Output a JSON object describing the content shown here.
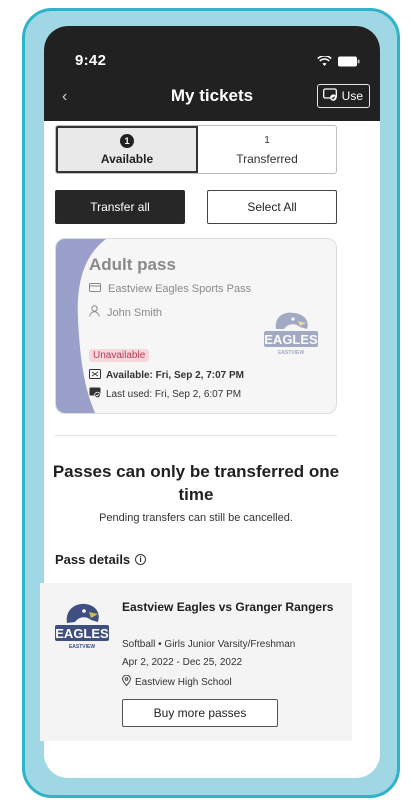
{
  "status_bar": {
    "time": "9:42"
  },
  "nav": {
    "title": "My tickets",
    "use_label": "Use"
  },
  "tabs": [
    {
      "count": "1",
      "label": "Available",
      "active": true
    },
    {
      "count": "1",
      "label": "Transferred",
      "active": false
    }
  ],
  "actions": {
    "transfer_all": "Transfer all",
    "select_all": "Select All"
  },
  "pass": {
    "title": "Adult pass",
    "pass_name": "Eastview Eagles Sports Pass",
    "holder": "John Smith",
    "status_badge": "Unavailable",
    "available_text": "Available: Fri, Sep 2, 7:07 PM",
    "last_used_text": "Last used: Fri, Sep 2, 6:07 PM",
    "logo_text": "EAGLES",
    "logo_subtext": "EASTVIEW"
  },
  "notice": {
    "headline": "Passes can only be transferred one time",
    "subline": "Pending transfers can still be cancelled."
  },
  "details": {
    "label": "Pass details",
    "event_title": "Eastview Eagles vs Granger Rangers",
    "sport_line": "Softball • Girls Junior Varsity/Freshman",
    "date_range": "Apr 2, 2022 - Dec 25, 2022",
    "location": "Eastview High School",
    "buy_label": "Buy more passes",
    "logo_text": "EAGLES",
    "logo_subtext": "EASTVIEW"
  },
  "colors": {
    "accent_frame": "#2eb3c9",
    "frame_fill": "#9fd8e4",
    "card_stripe": "#9aa0c9",
    "badge_bg": "#f8d7dc",
    "badge_text": "#b23b52"
  }
}
